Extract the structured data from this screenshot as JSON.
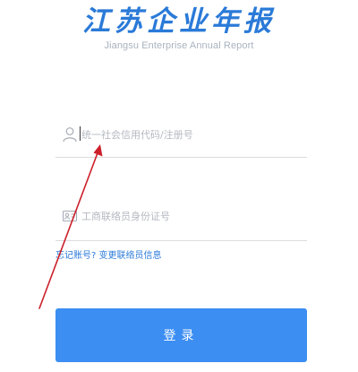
{
  "header": {
    "title": "江苏企业年报",
    "subtitle": "Jiangsu Enterprise Annual Report"
  },
  "form": {
    "credit_code_placeholder": "统一社会信用代码/注册号",
    "credit_code_value": "",
    "credit_code_icon": "user-icon",
    "id_number_placeholder": "工商联络员身份证号",
    "id_number_value": "",
    "id_number_icon": "id-card-icon"
  },
  "links": {
    "forgot_account": "忘记账号?",
    "change_contact": "变更联络员信息"
  },
  "login_button_label": "登录",
  "colors": {
    "brand": "#2a7ad8",
    "button": "#3c8ef3",
    "annotation": "#cc1f2a"
  }
}
